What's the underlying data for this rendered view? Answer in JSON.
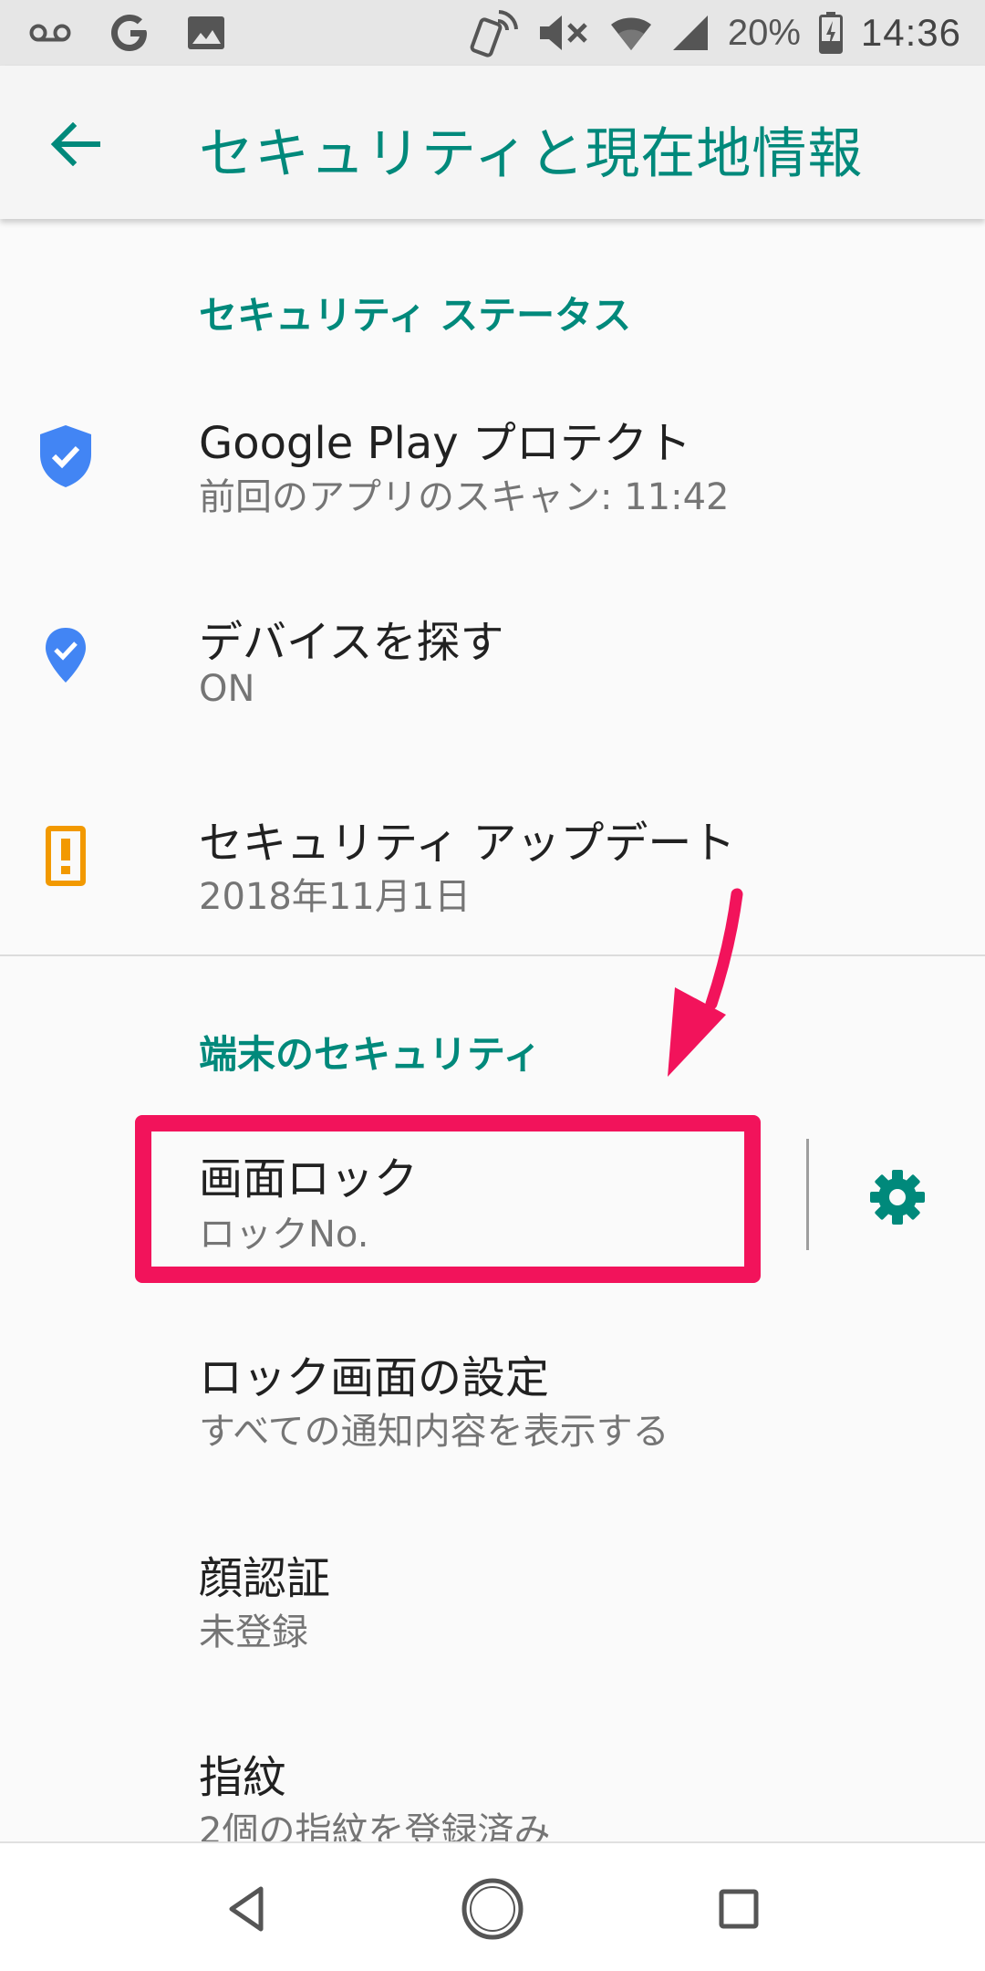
{
  "status_bar": {
    "battery_percent": "20%",
    "time": "14:36",
    "icons": [
      "voicemail-icon",
      "google-icon",
      "image-icon",
      "nfc-phone-icon",
      "mute-icon",
      "wifi-icon",
      "signal-icon",
      "battery-icon"
    ]
  },
  "app_bar": {
    "title": "セキュリティと現在地情報",
    "back_icon": "arrow-back-icon"
  },
  "security_status": {
    "header": "セキュリティ ステータス",
    "items": [
      {
        "title": "Google Play プロテクト",
        "subtitle": "前回のアプリのスキャン: 11:42",
        "icon": "shield-check-icon"
      },
      {
        "title": "デバイスを探す",
        "subtitle": "ON",
        "icon": "location-check-icon"
      },
      {
        "title": "セキュリティ アップデート",
        "subtitle": "2018年11月1日",
        "icon": "phone-alert-icon"
      }
    ]
  },
  "device_security": {
    "header": "端末のセキュリティ",
    "items": [
      {
        "title": "画面ロック",
        "subtitle": "ロックNo."
      },
      {
        "title": "ロック画面の設定",
        "subtitle": "すべての通知内容を表示する"
      },
      {
        "title": "顔認証",
        "subtitle": "未登録"
      },
      {
        "title": "指紋",
        "subtitle": "2個の指紋を登録済み"
      }
    ]
  },
  "colors": {
    "accent": "#00897b",
    "highlight": "#f2135b",
    "shield_blue": "#4285f4",
    "alert_orange": "#f29900"
  },
  "nav_bar": {
    "icons": [
      "back-triangle-icon",
      "home-circle-icon",
      "recents-square-icon"
    ]
  }
}
